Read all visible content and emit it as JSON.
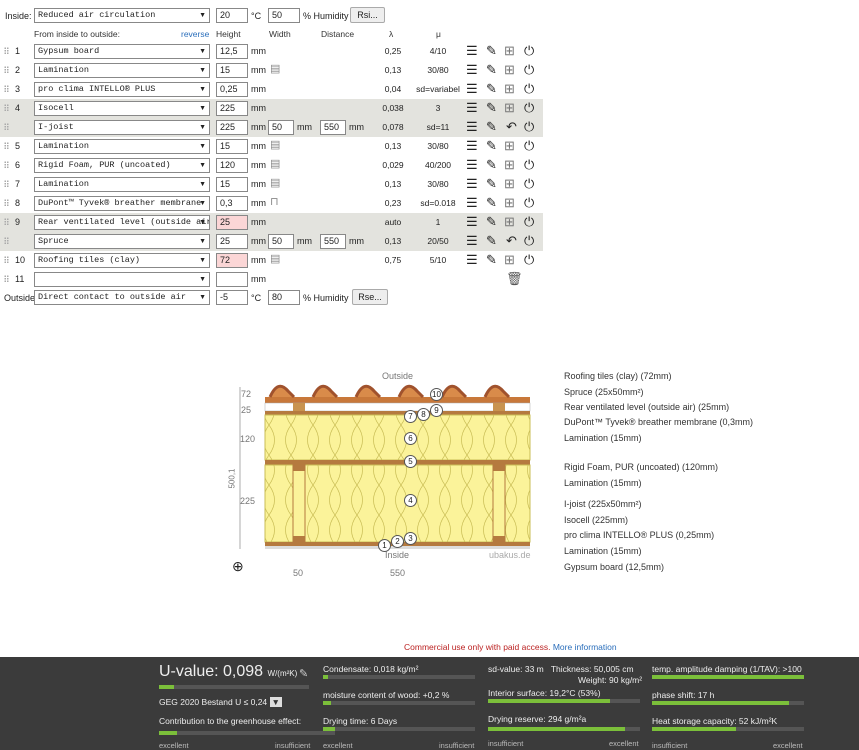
{
  "inside_row": {
    "label": "Inside:",
    "select": "Reduced air circulation",
    "temp": "20",
    "temp_unit": "°C",
    "humidity": "50",
    "humidity_unit": "% Humidity",
    "button": "Rsi..."
  },
  "headers": {
    "order": "From inside to outside:",
    "reverse": "reverse",
    "height": "Height",
    "width": "Width",
    "distance": "Distance",
    "lambda": "λ",
    "mu": "μ"
  },
  "layers": [
    {
      "num": "1",
      "name": "Gypsum board",
      "height": "12,5",
      "unit": "mm",
      "width": "",
      "distance": "",
      "lambda": "0,25",
      "mu": "4/10",
      "alt": false,
      "hatch": false,
      "tyvek": false,
      "undo": false
    },
    {
      "num": "2",
      "name": "Lamination",
      "height": "15",
      "unit": "mm",
      "width": "",
      "distance": "",
      "lambda": "0,13",
      "mu": "30/80",
      "alt": false,
      "hatch": true,
      "tyvek": false,
      "undo": false
    },
    {
      "num": "3",
      "name": "pro clima INTELLO® PLUS",
      "height": "0,25",
      "unit": "mm",
      "width": "",
      "distance": "",
      "lambda": "0,04",
      "mu": "sd=variabel",
      "alt": false,
      "hatch": false,
      "tyvek": false,
      "undo": false
    },
    {
      "num": "4",
      "name": "Isocell",
      "height": "225",
      "unit": "mm",
      "width": "",
      "distance": "",
      "lambda": "0,038",
      "mu": "3",
      "alt": true,
      "hatch": false,
      "tyvek": false,
      "undo": false
    },
    {
      "num": "",
      "name": "I-joist",
      "height": "225",
      "unit": "mm",
      "width": "50",
      "distance": "550",
      "lambda": "0,078",
      "mu": "sd=11",
      "alt": true,
      "hatch": false,
      "tyvek": false,
      "undo": true
    },
    {
      "num": "5",
      "name": "Lamination",
      "height": "15",
      "unit": "mm",
      "width": "",
      "distance": "",
      "lambda": "0,13",
      "mu": "30/80",
      "alt": false,
      "hatch": true,
      "tyvek": false,
      "undo": false
    },
    {
      "num": "6",
      "name": "Rigid Foam, PUR (uncoated)",
      "height": "120",
      "unit": "mm",
      "width": "",
      "distance": "",
      "lambda": "0,029",
      "mu": "40/200",
      "alt": false,
      "hatch": true,
      "tyvek": false,
      "undo": false
    },
    {
      "num": "7",
      "name": "Lamination",
      "height": "15",
      "unit": "mm",
      "width": "",
      "distance": "",
      "lambda": "0,13",
      "mu": "30/80",
      "alt": false,
      "hatch": true,
      "tyvek": false,
      "undo": false
    },
    {
      "num": "8",
      "name": "DuPont™ Tyvek® breather membrane",
      "height": "0,3",
      "unit": "mm",
      "width": "",
      "distance": "",
      "lambda": "0,23",
      "mu": "sd=0.018",
      "alt": false,
      "hatch": false,
      "tyvek": true,
      "undo": false
    },
    {
      "num": "9",
      "name": "Rear ventilated level (outside air)",
      "height": "25",
      "unit": "mm",
      "width": "",
      "distance": "",
      "lambda": "auto",
      "mu": "1",
      "alt": true,
      "hatch": false,
      "tyvek": false,
      "undo": false,
      "err": true
    },
    {
      "num": "",
      "name": "Spruce",
      "height": "25",
      "unit": "mm",
      "width": "50",
      "distance": "550",
      "lambda": "0,13",
      "mu": "20/50",
      "alt": true,
      "hatch": false,
      "tyvek": false,
      "undo": true
    },
    {
      "num": "10",
      "name": "Roofing tiles (clay)",
      "height": "72",
      "unit": "mm",
      "width": "",
      "distance": "",
      "lambda": "0,75",
      "mu": "5/10",
      "alt": false,
      "hatch": true,
      "tyvek": false,
      "undo": false,
      "err": true
    },
    {
      "num": "11",
      "name": "",
      "height": "",
      "unit": "mm",
      "width": "",
      "distance": "",
      "lambda": "",
      "mu": "",
      "alt": false,
      "hatch": false,
      "tyvek": false,
      "undo": false,
      "empty": true
    }
  ],
  "units": {
    "mm": "mm"
  },
  "outside_row": {
    "label": "Outside",
    "select": "Direct contact to outside air",
    "temp": "-5",
    "temp_unit": "°C",
    "humidity": "80",
    "humidity_unit": "% Humidity",
    "button": "Rse..."
  },
  "diagram": {
    "outside": "Outside",
    "inside": "Inside",
    "watermark": "ubakus.de",
    "dims_left": [
      "72",
      "25",
      "120",
      "225"
    ],
    "total": "500,1",
    "bottom_dims": [
      "50",
      "550"
    ],
    "callouts": [
      "10",
      "9",
      "8",
      "7",
      "6",
      "5",
      "4",
      "3",
      "2",
      "1"
    ],
    "labels": [
      "Roofing tiles (clay) (72mm)",
      "Spruce (25x50mm²)",
      "Rear ventilated level (outside air) (25mm)",
      "DuPont™ Tyvek® breather membrane (0,3mm)",
      "Lamination (15mm)",
      "Rigid Foam, PUR (uncoated) (120mm)",
      "Lamination (15mm)",
      "I-joist (225x50mm²)",
      "Isocell (225mm)",
      "pro clima INTELLO® PLUS (0,25mm)",
      "Lamination (15mm)",
      "Gypsum board (12,5mm)"
    ]
  },
  "notice": {
    "text": "Commercial use only with paid access.",
    "link": "More information"
  },
  "results": {
    "uvalue_label": "U-value:",
    "uvalue": "0,098",
    "uvalue_unit": "W/(m²K)",
    "geg": "GEG 2020 Bestand U ≤ 0,24",
    "greenhouse": "Contribution to the greenhouse effect:",
    "condensate": "Condensate: 0,018 kg/m²",
    "moisture": "moisture content of wood: +0,2 %",
    "drying_time": "Drying time: 6 Days",
    "sd": "sd-value: 33 m",
    "thickness": "Thickness: 50,005 cm",
    "weight": "Weight: 90 kg/m²",
    "interior": "Interior surface: 19,2°C (53%)",
    "drying_reserve": "Drying reserve: 294 g/m²a",
    "amplitude": "temp. amplitude damping (1/TAV): >100",
    "phase": "phase shift: 17 h",
    "heat": "Heat storage capacity: 52 kJ/m²K",
    "excellent": "excellent",
    "insufficient": "insufficient",
    "uvalue_fill": 0.1,
    "greenhouse_fill": 0.1,
    "condensate_fill": 0.03,
    "moisture_fill": 0.05,
    "drying_fill": 0.08,
    "interior_fill": 0.8,
    "reserve_fill": 0.9,
    "amplitude_fill": 1.0,
    "phase_fill": 0.9,
    "heat_fill": 0.55
  }
}
